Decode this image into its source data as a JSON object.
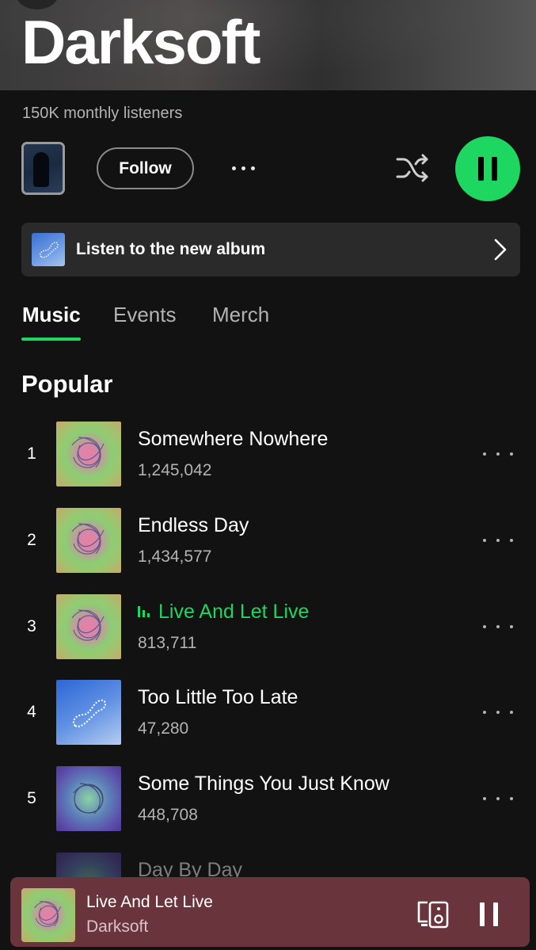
{
  "artist": {
    "name": "Darksoft",
    "monthly_listeners": "150K monthly listeners"
  },
  "actions": {
    "follow_label": "Follow",
    "more_icon": "more-horizontal-icon",
    "shuffle_icon": "shuffle-icon",
    "play_state": "pause-icon"
  },
  "album_banner": {
    "label": "Listen to the new album",
    "chevron_icon": "chevron-right-icon"
  },
  "tabs": [
    {
      "label": "Music",
      "active": true
    },
    {
      "label": "Events",
      "active": false
    },
    {
      "label": "Merch",
      "active": false
    }
  ],
  "popular": {
    "title": "Popular",
    "tracks": [
      {
        "rank": "1",
        "title": "Somewhere Nowhere",
        "plays": "1,245,042",
        "playing": false
      },
      {
        "rank": "2",
        "title": "Endless Day",
        "plays": "1,434,577",
        "playing": false
      },
      {
        "rank": "3",
        "title": "Live And Let Live",
        "plays": "813,711",
        "playing": true
      },
      {
        "rank": "4",
        "title": "Too Little Too Late",
        "plays": "47,280",
        "playing": false
      },
      {
        "rank": "5",
        "title": "Some Things You Just Know",
        "plays": "448,708",
        "playing": false
      },
      {
        "rank": "",
        "title": "Day By Day",
        "plays": "",
        "playing": false
      }
    ]
  },
  "now_playing": {
    "title": "Live And Let Live",
    "artist": "Darksoft",
    "device_icon": "connect-device-icon",
    "pause_icon": "pause-icon"
  },
  "colors": {
    "background": "#121212",
    "accent": "#1ed760",
    "mini_player": "#6a343c",
    "secondary_text": "#b3b3b3"
  }
}
